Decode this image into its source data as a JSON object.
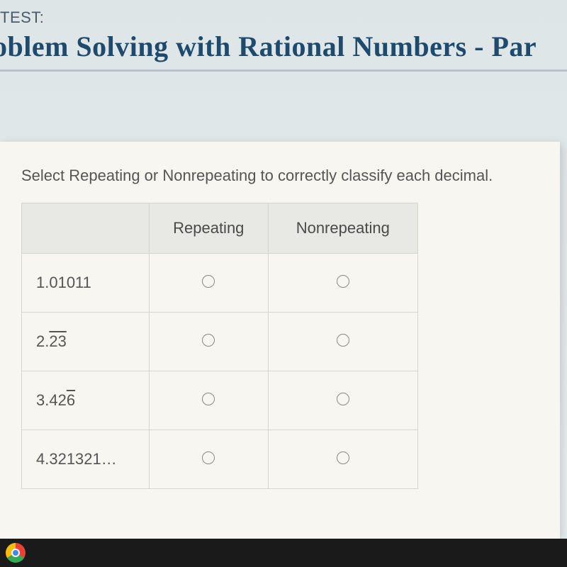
{
  "header": {
    "test_label": "TEST:",
    "title": "oblem Solving with Rational Numbers - Par"
  },
  "question": {
    "prompt": "Select Repeating or Nonrepeating to correctly classify each decimal."
  },
  "table": {
    "headers": {
      "blank": "",
      "col1": "Repeating",
      "col2": "Nonrepeating"
    },
    "rows": [
      {
        "label_prefix": "1.01011",
        "overline": ""
      },
      {
        "label_prefix": "2.",
        "overline": "23"
      },
      {
        "label_prefix": "3.42",
        "overline": "6"
      },
      {
        "label_prefix": "4.321321…",
        "overline": ""
      }
    ]
  }
}
